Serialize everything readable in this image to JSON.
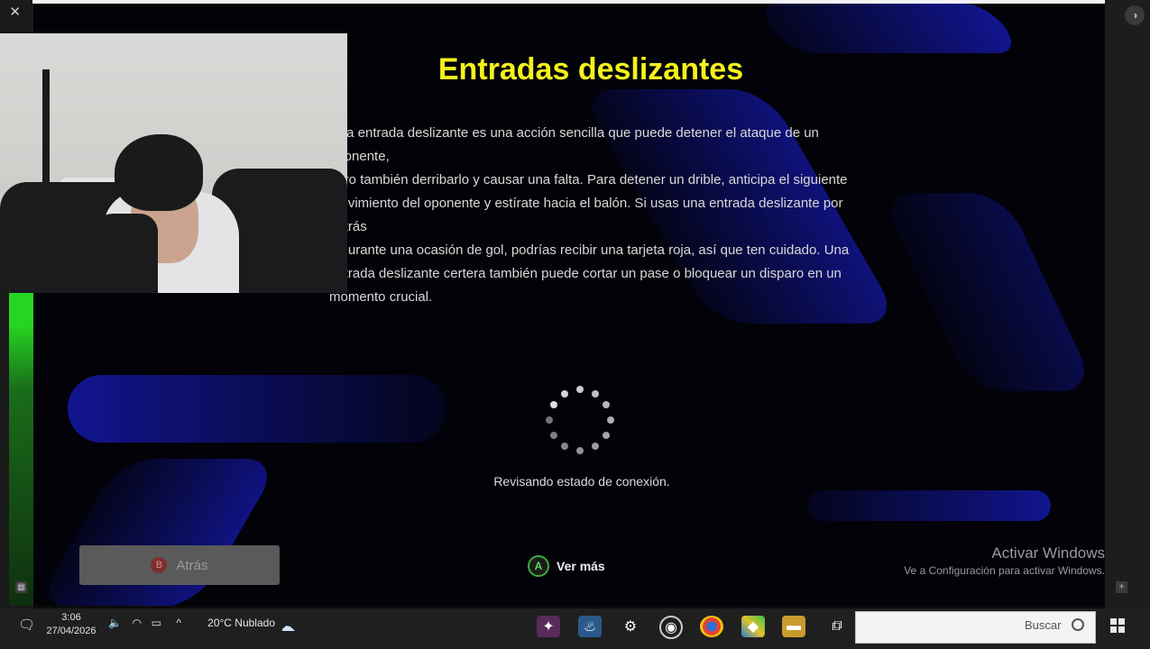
{
  "screen": {
    "title": "Entradas deslizantes"
  },
  "tutorial": {
    "title": "Entradas deslizantes",
    "lines": [
      "Una entrada deslizante es una acción sencilla que puede detener el ataque de un oponente,",
      "pero también derribarlo y causar una falta. Para detener un drible, anticipa el siguiente",
      "movimiento del oponente y estírate hacia el balón. Si usas una entrada deslizante por detrás",
      "o durante una ocasión de gol, podrías recibir una tarjeta roja, así que ten cuidado. Una",
      "entrada deslizante certera también puede cortar un pase o bloquear un disparo en un",
      "momento crucial."
    ],
    "status": "Revisando estado de conexión.",
    "ver_mas": {
      "button": "A",
      "label": "Ver más"
    },
    "atras": {
      "button": "B",
      "label": "Atrás"
    }
  },
  "watermark": {
    "line1": "Activar Windows",
    "line2": "Ve a Configuración para activar Windows."
  },
  "taskbar": {
    "search_placeholder": "Buscar",
    "weather": "20°C  Nublado",
    "time": "3:06",
    "date": "27/04/2026",
    "pinned": [
      "task-view-icon",
      "file-explorer-icon",
      "bluestacks-icon",
      "chrome-icon",
      "obs-icon",
      "settings-icon",
      "steam-icon",
      "game-icon"
    ]
  },
  "colors": {
    "title_yellow": "#f5f21a",
    "accent_blue": "#1216a0",
    "green_bar": "#25d521",
    "back_button": "#5a5a5a"
  }
}
